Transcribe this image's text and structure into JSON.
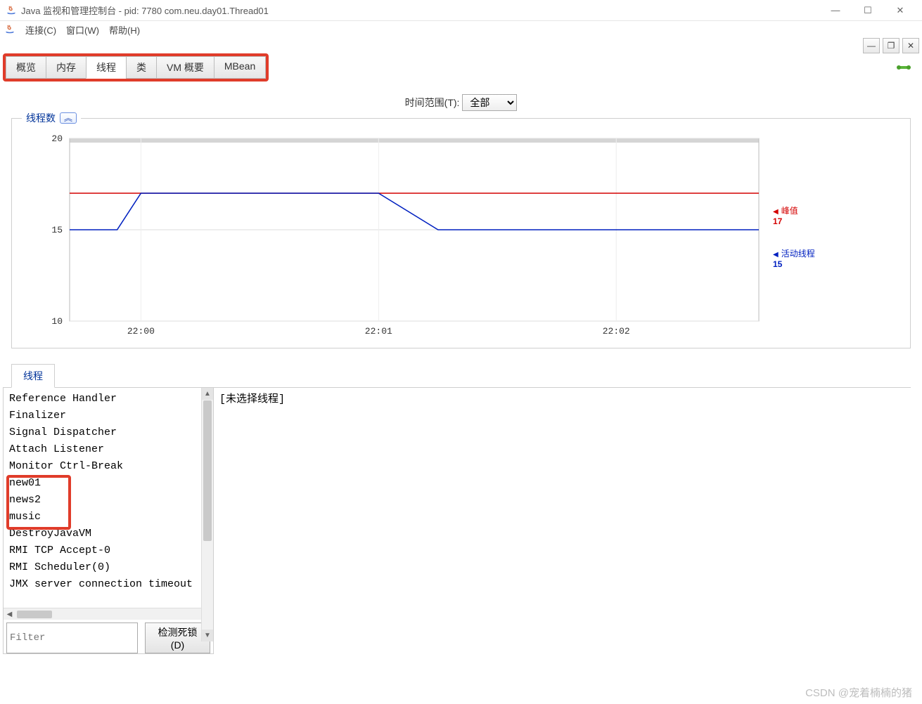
{
  "window": {
    "title": "Java 监视和管理控制台 - pid: 7780 com.neu.day01.Thread01"
  },
  "menu": {
    "connect": "连接(C)",
    "window": "窗口(W)",
    "help": "帮助(H)"
  },
  "tabs": {
    "items": [
      "概览",
      "内存",
      "线程",
      "类",
      "VM 概要",
      "MBean"
    ],
    "active_index": 2
  },
  "time_range": {
    "label": "时间范围(T):",
    "value": "全部"
  },
  "chart_fieldset": {
    "title": "线程数"
  },
  "chart_legend": {
    "peak_label": "峰值",
    "peak_value": "17",
    "live_label": "活动线程",
    "live_value": "15"
  },
  "chart_data": {
    "type": "line",
    "xlabel": "",
    "ylabel": "",
    "ylim": [
      10,
      20
    ],
    "y_ticks": [
      10,
      15,
      20
    ],
    "x_ticks": [
      "22:00",
      "22:01",
      "22:02"
    ],
    "x_range_minutes": [
      -0.3,
      2.6
    ],
    "series": [
      {
        "name": "峰值",
        "color": "#d40000",
        "points": [
          [
            -0.3,
            17
          ],
          [
            2.6,
            17
          ]
        ]
      },
      {
        "name": "活动线程",
        "color": "#0020c0",
        "points": [
          [
            -0.3,
            15
          ],
          [
            -0.1,
            15
          ],
          [
            0.0,
            17
          ],
          [
            1.0,
            17
          ],
          [
            1.25,
            15
          ],
          [
            2.6,
            15
          ]
        ]
      }
    ]
  },
  "threads_section": {
    "tab_label": "线程",
    "detail_placeholder": "[未选择线程]",
    "items": [
      "Reference Handler",
      "Finalizer",
      "Signal Dispatcher",
      "Attach Listener",
      "Monitor Ctrl-Break",
      "new01",
      "news2",
      "music",
      "DestroyJavaVM",
      "RMI TCP Accept-0",
      "RMI Scheduler(0)",
      "JMX server connection timeout"
    ],
    "filter_placeholder": "Filter",
    "deadlock_button": "检测死锁(D)"
  },
  "watermark": "CSDN @宠着楠楠的猪"
}
